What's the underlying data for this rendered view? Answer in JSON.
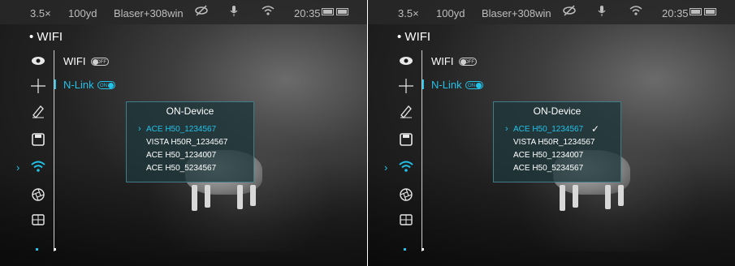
{
  "screens": [
    {
      "status": {
        "magnification": "3.5×",
        "distance": "100yd",
        "profile": "Blaser+308win",
        "time": "20:35"
      },
      "menu": {
        "title": "• WIFI",
        "wifi_label": "WIFI",
        "wifi_toggle": "OFF",
        "nlink_label": "N-Link",
        "nlink_toggle": "ON"
      },
      "dialog": {
        "title": "ON-Device",
        "devices": [
          "ACE H50_1234567",
          "VISTA H50R_1234567",
          "ACE H50_1234007",
          "ACE H50_5234567"
        ],
        "selected_index": 0,
        "connected": false
      }
    },
    {
      "status": {
        "magnification": "3.5×",
        "distance": "100yd",
        "profile": "Blaser+308win",
        "time": "20:35"
      },
      "menu": {
        "title": "• WIFI",
        "wifi_label": "WIFI",
        "wifi_toggle": "OFF",
        "nlink_label": "N-Link",
        "nlink_toggle": "ON"
      },
      "dialog": {
        "title": "ON-Device",
        "devices": [
          "ACE H50_1234567",
          "VISTA H50R_1234567",
          "ACE H50_1234007",
          "ACE H50_5234567"
        ],
        "selected_index": 0,
        "connected": true,
        "check_mark": "✓"
      }
    }
  ],
  "icons": {
    "eye": "eye-icon",
    "crosshair": "crosshair-icon",
    "pen": "pen-icon",
    "save": "save-icon",
    "wifi": "wifi-icon",
    "aperture": "aperture-icon",
    "grid": "grid-icon"
  },
  "colors": {
    "accent": "#22c1e8",
    "text": "#ffffff",
    "status_text": "#bdbdbd"
  }
}
